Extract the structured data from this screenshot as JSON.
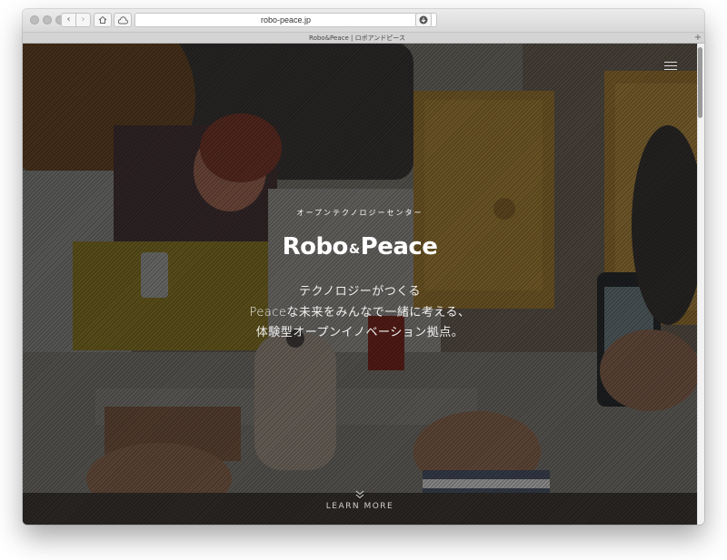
{
  "browser": {
    "url": "robo-peace.jp",
    "tab_title": "Robo&Peace | ロボアンドピース",
    "nav_back": "‹",
    "nav_forward": "›",
    "new_tab": "+"
  },
  "hero": {
    "tagline": "オープンテクノロジーセンター",
    "logo_left": "Robo",
    "logo_amp": "&",
    "logo_right": "Peace",
    "lines": [
      "テクノロジーがつくる",
      "Peaceな未来をみんなで一緒に考える、",
      "体験型オープンイノベーション拠点。"
    ],
    "learn_more": "LEARN MORE"
  },
  "icons": {
    "home": "home-icon",
    "cloud": "cloud-icon",
    "reload": "reload-icon",
    "download": "download-icon",
    "menu": "hamburger-menu-icon",
    "chevron": "double-chevron-down-icon"
  }
}
